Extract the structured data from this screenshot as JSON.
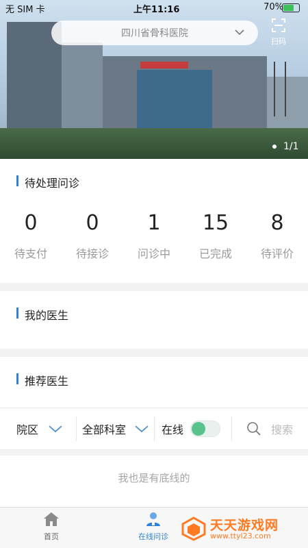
{
  "status_bar": {
    "carrier": "无 SIM 卡",
    "time": "上午11:16",
    "battery": "70%",
    "battery_level": 0.7
  },
  "header": {
    "hospital": "四川省骨科医院",
    "scan_label": "扫码",
    "banner_indicator": "1/1"
  },
  "pending": {
    "title": "待处理问诊",
    "stats": [
      {
        "value": "0",
        "label": "待支付"
      },
      {
        "value": "0",
        "label": "待接诊"
      },
      {
        "value": "1",
        "label": "问诊中"
      },
      {
        "value": "15",
        "label": "已完成"
      },
      {
        "value": "8",
        "label": "待评价"
      }
    ]
  },
  "my_doctor": {
    "title": "我的医生"
  },
  "recommended": {
    "title": "推荐医生"
  },
  "filters": {
    "campus": "院区",
    "department": "全部科室",
    "online": "在线",
    "online_on": true,
    "search_placeholder": "搜索"
  },
  "footer_note": "我也是有底线的",
  "tabs": [
    {
      "label": "首页",
      "icon": "home-icon",
      "active": false
    },
    {
      "label": "在线问诊",
      "icon": "doctor-icon",
      "active": true
    }
  ],
  "watermark": {
    "title": "天天游戏网",
    "url": "www.ttyl23.com"
  },
  "colors": {
    "accent": "#2f80d9",
    "toggle_on": "#57c28b",
    "watermark": "#ff7a20"
  }
}
